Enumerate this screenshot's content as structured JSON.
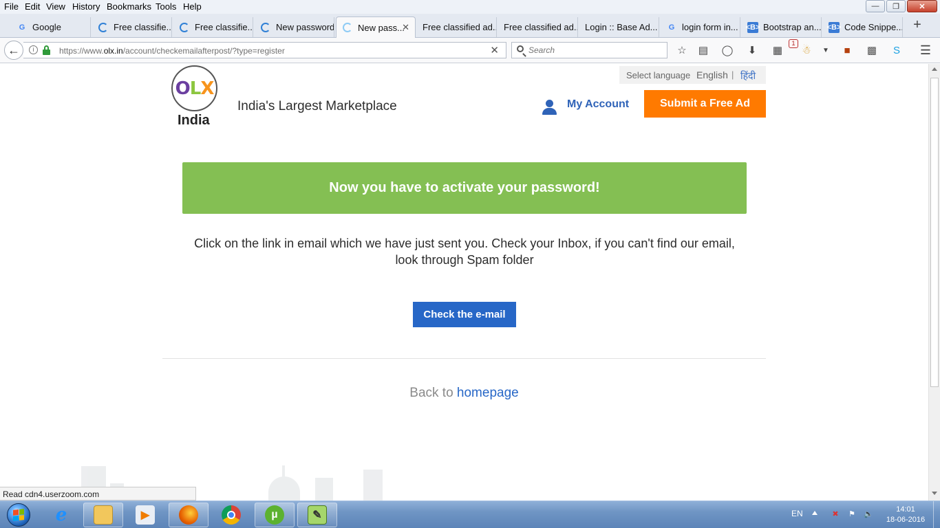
{
  "menubar": {
    "items": [
      "File",
      "Edit",
      "View",
      "History",
      "Bookmarks",
      "Tools",
      "Help"
    ]
  },
  "tabs": [
    {
      "label": "Google",
      "icon": "google-icon"
    },
    {
      "label": "Free classifie...",
      "icon": "loading-spinner-icon"
    },
    {
      "label": "Free classifie...",
      "icon": "loading-spinner-icon"
    },
    {
      "label": "New password",
      "icon": "loading-spinner-icon"
    },
    {
      "label": "New pass...",
      "icon": "loading-spinner-icon",
      "active": true
    },
    {
      "label": "Free classified ad...",
      "icon": ""
    },
    {
      "label": "Free classified ad...",
      "icon": ""
    },
    {
      "label": "Login :: Base Ad...",
      "icon": ""
    },
    {
      "label": "login form in...",
      "icon": "google-icon"
    },
    {
      "label": "Bootstrap an...",
      "icon": "bootstrap-icon"
    },
    {
      "label": "Code Snippe...",
      "icon": "bootstrap-icon"
    }
  ],
  "navbar": {
    "url_prefix": "https://www.",
    "url_domain": "olx.in",
    "url_path": "/account/checkemailafterpost/?type=register",
    "search_placeholder": "Search",
    "notification_count": "1"
  },
  "header": {
    "logo_text": "OLX",
    "logo_country": "India",
    "tagline": "India's Largest Marketplace",
    "select_language": "Select language",
    "lang_english": "English",
    "lang_separator": "|",
    "lang_hindi": "हिंदी",
    "my_account": "My Account",
    "submit_ad": "Submit a Free Ad"
  },
  "main": {
    "notice": "Now you have to activate your password!",
    "instructions": "Click on the link in email which we have just sent you. Check your Inbox, if you can't find our email, look through Spam folder",
    "check_email_button": "Check the e-mail",
    "back_prefix": "Back to",
    "homepage_link": "homepage"
  },
  "status_bar": {
    "text": "Read cdn4.userzoom.com"
  },
  "taskbar": {
    "language": "EN",
    "time": "14:01",
    "date": "18-06-2016"
  },
  "colors": {
    "notice_green": "#84bf53",
    "submit_orange": "#ff7a00",
    "link_blue": "#2767c7",
    "olx_purple": "#6b3fa0",
    "olx_green": "#8cc63f",
    "olx_orange": "#f7941d"
  }
}
